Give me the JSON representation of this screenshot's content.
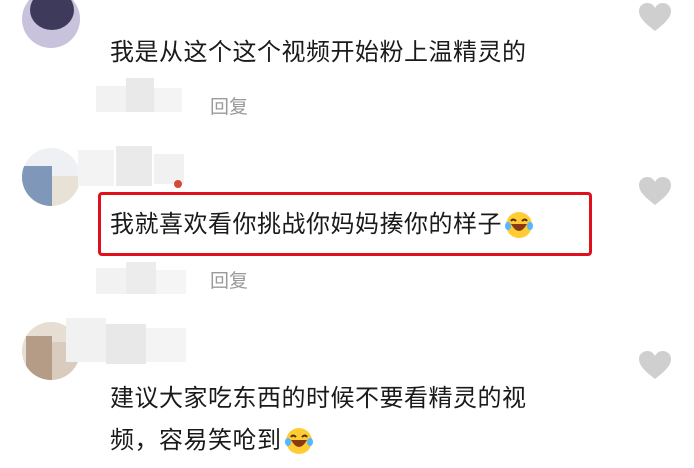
{
  "comments": [
    {
      "text": "我是从这个这个视频开始粉上温精灵的",
      "reply_label": "回复"
    },
    {
      "text": "我就喜欢看你挑战你妈妈揍你的样子",
      "reply_label": "回复",
      "emoji": "laughing-crying-emoji",
      "highlighted": true,
      "highlight_color": "#e0101a"
    },
    {
      "text_line1": "建议大家吃东西的时候不要看精灵的视",
      "text_line2": "频，容易笑呛到",
      "emoji": "laughing-crying-emoji"
    }
  ],
  "icons": {
    "like": "heart-icon"
  },
  "colors": {
    "text": "#1a1a1a",
    "reply": "#9a9a9a",
    "heart": "#cfcfcf"
  }
}
